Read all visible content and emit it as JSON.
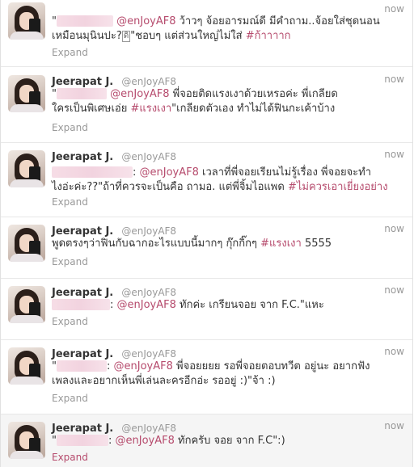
{
  "tweets": [
    {
      "name": "",
      "handle": "",
      "time": "now",
      "prefix": "\"",
      "mention": "@enJoyAF8",
      "text_a": " ว้าวๆ จ้อยอารมณ์ดี มีคำถาม..จ้อยใส่ชุดนอน\nเหมือนมุนินปะ?",
      "emoji": "ดิ",
      "text_b": "\"ชอบๆ แต่ส่วนใหญ่ไม่ใส่ ",
      "hashtag": "#ก้าาาาก",
      "suffix": "",
      "expand": "Expand"
    },
    {
      "name": "",
      "handle": "",
      "time": "now",
      "prefix": "\"",
      "mention": "@enJoyAF8",
      "text_a": " พี่จอยติดแรงเงาด้วยเหรอค่ะ พี่เกลียด\nใครเป็นพิเศษเอ่ย ",
      "hashtag": "#แรงเงา",
      "text_b": "\"เกลียดตัวเอง ทำไม่ได้ฟินกะเค้าบ้าง",
      "suffix": "",
      "expand": "Expand"
    },
    {
      "name": "",
      "handle": "",
      "time": "now",
      "prefix": "",
      "mention": "@enJoyAF8",
      "text_a": " เวลาที่พี่จอยเรียนไม่รู้เรื่อง พี่จอยจะทำ\nไงอ่ะค่ะ??\"ถ้าที่ควรจะเป็นคือ ถามอ. แต่พี่จิ้มไอแพด ",
      "hashtag": "#ไม่ควรเอาเยี่ยงอย่าง",
      "text_b": "",
      "suffix": "",
      "expand": "Expand"
    },
    {
      "name": "Jeerapat J.",
      "handle": "@enJoyAF8",
      "time": "now",
      "prefix": "พูดตรงๆว่าฟินกับฉากอะไรแบบนี้มากๆ กุ๊กกิ๊กๆ ",
      "mention": "",
      "text_a": "",
      "hashtag": "#แรงเงา",
      "text_b": " 5555",
      "suffix": "",
      "expand": "Expand"
    },
    {
      "name": "Jeerapat J.",
      "handle": "@enJoyAF8",
      "time": "now",
      "prefix": "",
      "mention": "@enJoyAF8",
      "text_a": " ทักค่ะ เกรียนจอย จาก F.C.\"แหะ",
      "hashtag": "",
      "text_b": "",
      "suffix": "",
      "expand": "Expand"
    },
    {
      "name": "Jeerapat J.",
      "handle": "@enJoyAF8",
      "time": "now",
      "prefix": "\"",
      "mention": "@enJoyAF8",
      "text_a": " พี่จอยยยย รอพี่จอยตอบทวีต อยู่นะ อยากฟัง\nเพลงและอยากเห็นพี่เล่นละครอีกอ่ะ รออยู่ :)\"จ้า :)",
      "hashtag": "",
      "text_b": "",
      "suffix": "",
      "expand": "Expand"
    },
    {
      "name": "Jeerapat J.",
      "handle": "@enJoyAF8",
      "time": "now",
      "prefix": "\"",
      "mention": "@enJoyAF8",
      "text_a": " ทักครับ จอย จาก F.C\":)",
      "hashtag": "",
      "text_b": "",
      "suffix": "",
      "expand": "Expand"
    }
  ],
  "header_top": {
    "name2": "Jeerapat J.",
    "handle2": "@enJoyAF8",
    "name3": "Jeerapat J.",
    "handle3": "@enJoyAF8"
  },
  "colors": {
    "link": "#b64b6d",
    "meta": "#999999",
    "text": "#333333"
  }
}
